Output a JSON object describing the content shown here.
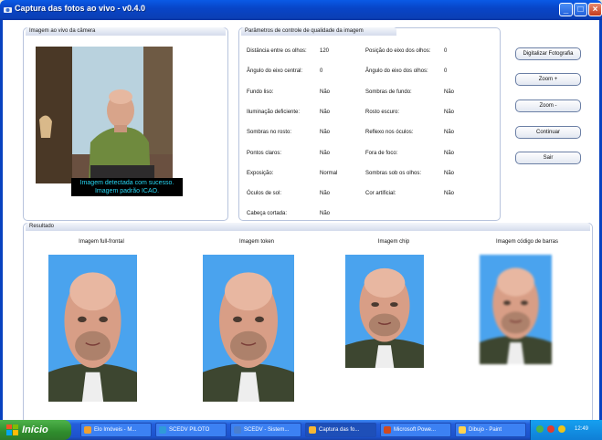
{
  "window": {
    "title": "Captura das fotos ao vivo - v0.4.0"
  },
  "camera": {
    "group_title": "Imagem ao vivo da câmera",
    "message_line1": "Imagem detectada com sucesso.",
    "message_line2": "Imagem padrão ICAO."
  },
  "params": {
    "group_title": "Parâmetros de controle de qualidade da imagem",
    "left": [
      {
        "label": "Distância entre os olhos:",
        "value": "120"
      },
      {
        "label": "Ângulo do eixo central:",
        "value": "0"
      },
      {
        "label": "Fundo liso:",
        "value": "Não"
      },
      {
        "label": "Iluminação deficiente:",
        "value": "Não"
      },
      {
        "label": "Sombras no rosto:",
        "value": "Não"
      },
      {
        "label": "Pontos claros:",
        "value": "Não"
      },
      {
        "label": "Exposição:",
        "value": "Normal"
      },
      {
        "label": "Óculos de sol:",
        "value": "Não"
      },
      {
        "label": "Cabeça cortada:",
        "value": "Não"
      }
    ],
    "right": [
      {
        "label": "Posição do eixo dos olhos:",
        "value": "0"
      },
      {
        "label": "Ângulo do eixo dos olhos:",
        "value": "0"
      },
      {
        "label": "Sombras de fundo:",
        "value": "Não"
      },
      {
        "label": "Rosto escuro:",
        "value": "Não"
      },
      {
        "label": "Reflexo nos óculos:",
        "value": "Não"
      },
      {
        "label": "Fora de foco:",
        "value": "Não"
      },
      {
        "label": "Sombras sob os olhos:",
        "value": "Não"
      },
      {
        "label": "Cor artificial:",
        "value": "Não"
      }
    ]
  },
  "buttons": {
    "digitize": "Digitalizar Fotografia",
    "zoom_in": "Zoom +",
    "zoom_out": "Zoom -",
    "continue": "Continuar",
    "exit": "Sair"
  },
  "result": {
    "group_title": "Resultado",
    "labels": [
      "Imagem full-frontal",
      "Imagem token",
      "Imagem chip",
      "Imagem código de barras"
    ]
  },
  "taskbar": {
    "start": "Início",
    "tasks": [
      "Elo Imóveis - M...",
      "SCEDV PILOTO",
      "SCEDV - Sistem...",
      "Captura das fo...",
      "Microsoft Powe...",
      "Dibujo - Paint"
    ],
    "clock": "12:49"
  },
  "colors": {
    "title_bar": "#0a5ae6",
    "photo_bg": "#4aa3ee",
    "cam_text": "#26d6f3"
  }
}
